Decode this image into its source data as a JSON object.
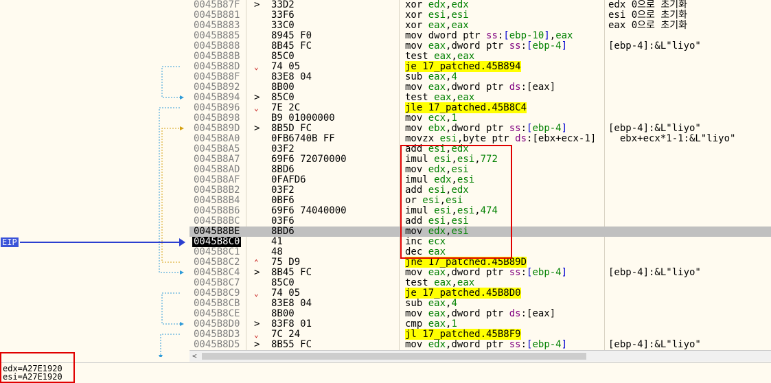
{
  "eip_label": "EIP",
  "colors": {
    "jump_highlight": "#ffff00",
    "eip_bg": "#3a53d8",
    "box": "#e00000",
    "current_row": "#c0c0c0"
  },
  "rows": [
    {
      "addr": "0045B87F",
      "mk": ">",
      "bytes": "33D2",
      "dis": [
        [
          "k",
          "xor "
        ],
        [
          "r",
          "edx"
        ],
        [
          "k",
          ","
        ],
        [
          "r",
          "edx"
        ]
      ],
      "cmt": "edx 0으로 초기화"
    },
    {
      "addr": "0045B881",
      "mk": "",
      "bytes": "33F6",
      "dis": [
        [
          "k",
          "xor "
        ],
        [
          "r",
          "esi"
        ],
        [
          "k",
          ","
        ],
        [
          "r",
          "esi"
        ]
      ],
      "cmt": "esi 0으로 초기화"
    },
    {
      "addr": "0045B883",
      "mk": "",
      "bytes": "33C0",
      "dis": [
        [
          "k",
          "xor "
        ],
        [
          "r",
          "eax"
        ],
        [
          "k",
          ","
        ],
        [
          "r",
          "eax"
        ]
      ],
      "cmt": "eax 0으로 초기화"
    },
    {
      "addr": "0045B885",
      "mk": "",
      "bytes": "8945 F0",
      "dis": [
        [
          "k",
          "mov dword ptr "
        ],
        [
          "s",
          "ss"
        ],
        [
          "k",
          ":"
        ],
        [
          "b",
          "["
        ],
        [
          "r",
          "ebp-10"
        ],
        [
          "b",
          "]"
        ],
        [
          "k",
          ","
        ],
        [
          "r",
          "eax"
        ]
      ],
      "cmt": ""
    },
    {
      "addr": "0045B888",
      "mk": "",
      "bytes": "8B45 FC",
      "dis": [
        [
          "k",
          "mov "
        ],
        [
          "r",
          "eax"
        ],
        [
          "k",
          ",dword ptr "
        ],
        [
          "s",
          "ss"
        ],
        [
          "k",
          ":"
        ],
        [
          "b",
          "["
        ],
        [
          "r",
          "ebp-4"
        ],
        [
          "b",
          "]"
        ]
      ],
      "cmt": "[ebp-4]:&L\"liyo\""
    },
    {
      "addr": "0045B88B",
      "mk": "",
      "bytes": "85C0",
      "dis": [
        [
          "k",
          "test "
        ],
        [
          "r",
          "eax"
        ],
        [
          "k",
          ","
        ],
        [
          "r",
          "eax"
        ]
      ],
      "cmt": ""
    },
    {
      "addr": "0045B88D",
      "mk": "v",
      "bytes": "74 05",
      "dis": [
        [
          "j",
          "je 17_patched.45B894"
        ]
      ],
      "cmt": ""
    },
    {
      "addr": "0045B88F",
      "mk": "",
      "bytes": "83E8 04",
      "dis": [
        [
          "k",
          "sub "
        ],
        [
          "r",
          "eax"
        ],
        [
          "k",
          ","
        ],
        [
          "n",
          "4"
        ]
      ],
      "cmt": ""
    },
    {
      "addr": "0045B892",
      "mk": "",
      "bytes": "8B00",
      "dis": [
        [
          "k",
          "mov "
        ],
        [
          "r",
          "eax"
        ],
        [
          "k",
          ",dword ptr "
        ],
        [
          "s",
          "ds"
        ],
        [
          "k",
          ":[eax]"
        ]
      ],
      "cmt": ""
    },
    {
      "addr": "0045B894",
      "mk": ">",
      "bytes": "85C0",
      "dis": [
        [
          "k",
          "test "
        ],
        [
          "r",
          "eax"
        ],
        [
          "k",
          ","
        ],
        [
          "r",
          "eax"
        ]
      ],
      "cmt": ""
    },
    {
      "addr": "0045B896",
      "mk": "v",
      "bytes": "7E 2C",
      "dis": [
        [
          "j",
          "jle 17_patched.45B8C4"
        ]
      ],
      "cmt": ""
    },
    {
      "addr": "0045B898",
      "mk": "",
      "bytes": "B9 01000000",
      "dis": [
        [
          "k",
          "mov "
        ],
        [
          "r",
          "ecx"
        ],
        [
          "k",
          ","
        ],
        [
          "n",
          "1"
        ]
      ],
      "cmt": ""
    },
    {
      "addr": "0045B89D",
      "mk": ">",
      "bytes": "8B5D FC",
      "dis": [
        [
          "k",
          "mov "
        ],
        [
          "r",
          "ebx"
        ],
        [
          "k",
          ",dword ptr "
        ],
        [
          "s",
          "ss"
        ],
        [
          "k",
          ":"
        ],
        [
          "b",
          "["
        ],
        [
          "r",
          "ebp-4"
        ],
        [
          "b",
          "]"
        ]
      ],
      "cmt": "[ebp-4]:&L\"liyo\""
    },
    {
      "addr": "0045B8A0",
      "mk": "",
      "bytes": "0FB6740B FF",
      "dis": [
        [
          "k",
          "movzx "
        ],
        [
          "r",
          "esi"
        ],
        [
          "k",
          ",byte ptr "
        ],
        [
          "s",
          "ds"
        ],
        [
          "k",
          ":[ebx+ecx-1]"
        ]
      ],
      "cmt": "  ebx+ecx*1-1:&L\"liyo\""
    },
    {
      "addr": "0045B8A5",
      "mk": "",
      "bytes": "03F2",
      "dis": [
        [
          "k",
          "add "
        ],
        [
          "r",
          "esi"
        ],
        [
          "k",
          ","
        ],
        [
          "r",
          "edx"
        ]
      ],
      "cmt": ""
    },
    {
      "addr": "0045B8A7",
      "mk": "",
      "bytes": "69F6 72070000",
      "dis": [
        [
          "k",
          "imul "
        ],
        [
          "r",
          "esi"
        ],
        [
          "k",
          ","
        ],
        [
          "r",
          "esi"
        ],
        [
          "k",
          ","
        ],
        [
          "n",
          "772"
        ]
      ],
      "cmt": ""
    },
    {
      "addr": "0045B8AD",
      "mk": "",
      "bytes": "8BD6",
      "dis": [
        [
          "k",
          "mov "
        ],
        [
          "r",
          "edx"
        ],
        [
          "k",
          ","
        ],
        [
          "r",
          "esi"
        ]
      ],
      "cmt": ""
    },
    {
      "addr": "0045B8AF",
      "mk": "",
      "bytes": "0FAFD6",
      "dis": [
        [
          "k",
          "imul "
        ],
        [
          "r",
          "edx"
        ],
        [
          "k",
          ","
        ],
        [
          "r",
          "esi"
        ]
      ],
      "cmt": ""
    },
    {
      "addr": "0045B8B2",
      "mk": "",
      "bytes": "03F2",
      "dis": [
        [
          "k",
          "add "
        ],
        [
          "r",
          "esi"
        ],
        [
          "k",
          ","
        ],
        [
          "r",
          "edx"
        ]
      ],
      "cmt": ""
    },
    {
      "addr": "0045B8B4",
      "mk": "",
      "bytes": "0BF6",
      "dis": [
        [
          "k",
          "or "
        ],
        [
          "r",
          "esi"
        ],
        [
          "k",
          ","
        ],
        [
          "r",
          "esi"
        ]
      ],
      "cmt": ""
    },
    {
      "addr": "0045B8B6",
      "mk": "",
      "bytes": "69F6 74040000",
      "dis": [
        [
          "k",
          "imul "
        ],
        [
          "r",
          "esi"
        ],
        [
          "k",
          ","
        ],
        [
          "r",
          "esi"
        ],
        [
          "k",
          ","
        ],
        [
          "n",
          "474"
        ]
      ],
      "cmt": ""
    },
    {
      "addr": "0045B8BC",
      "mk": "",
      "bytes": "03F6",
      "dis": [
        [
          "k",
          "add "
        ],
        [
          "r",
          "esi"
        ],
        [
          "k",
          ","
        ],
        [
          "r",
          "esi"
        ]
      ],
      "cmt": ""
    },
    {
      "addr": "0045B8BE",
      "mk": "",
      "bytes": "8BD6",
      "dis": [
        [
          "k",
          "mov "
        ],
        [
          "r",
          "edx"
        ],
        [
          "k",
          ","
        ],
        [
          "r",
          "esi"
        ]
      ],
      "cmt": "",
      "hl": true
    },
    {
      "addr": "0045B8C0",
      "mk": "",
      "bytes": "41",
      "dis": [
        [
          "k",
          "inc "
        ],
        [
          "r",
          "ecx"
        ]
      ],
      "cmt": "",
      "cur": true
    },
    {
      "addr": "0045B8C1",
      "mk": "",
      "bytes": "48",
      "dis": [
        [
          "k",
          "dec "
        ],
        [
          "r",
          "eax"
        ]
      ],
      "cmt": ""
    },
    {
      "addr": "0045B8C2",
      "mk": "^",
      "bytes": "75 D9",
      "dis": [
        [
          "j",
          "jne 17_patched.45B89D"
        ]
      ],
      "cmt": ""
    },
    {
      "addr": "0045B8C4",
      "mk": ">",
      "bytes": "8B45 FC",
      "dis": [
        [
          "k",
          "mov "
        ],
        [
          "r",
          "eax"
        ],
        [
          "k",
          ",dword ptr "
        ],
        [
          "s",
          "ss"
        ],
        [
          "k",
          ":"
        ],
        [
          "b",
          "["
        ],
        [
          "r",
          "ebp-4"
        ],
        [
          "b",
          "]"
        ]
      ],
      "cmt": "[ebp-4]:&L\"liyo\""
    },
    {
      "addr": "0045B8C7",
      "mk": "",
      "bytes": "85C0",
      "dis": [
        [
          "k",
          "test "
        ],
        [
          "r",
          "eax"
        ],
        [
          "k",
          ","
        ],
        [
          "r",
          "eax"
        ]
      ],
      "cmt": ""
    },
    {
      "addr": "0045B8C9",
      "mk": "v",
      "bytes": "74 05",
      "dis": [
        [
          "j",
          "je 17_patched.45B8D0"
        ]
      ],
      "cmt": ""
    },
    {
      "addr": "0045B8CB",
      "mk": "",
      "bytes": "83E8 04",
      "dis": [
        [
          "k",
          "sub "
        ],
        [
          "r",
          "eax"
        ],
        [
          "k",
          ","
        ],
        [
          "n",
          "4"
        ]
      ],
      "cmt": ""
    },
    {
      "addr": "0045B8CE",
      "mk": "",
      "bytes": "8B00",
      "dis": [
        [
          "k",
          "mov "
        ],
        [
          "r",
          "eax"
        ],
        [
          "k",
          ",dword ptr "
        ],
        [
          "s",
          "ds"
        ],
        [
          "k",
          ":[eax]"
        ]
      ],
      "cmt": ""
    },
    {
      "addr": "0045B8D0",
      "mk": ">",
      "bytes": "83F8 01",
      "dis": [
        [
          "k",
          "cmp "
        ],
        [
          "r",
          "eax"
        ],
        [
          "k",
          ","
        ],
        [
          "n",
          "1"
        ]
      ],
      "cmt": ""
    },
    {
      "addr": "0045B8D3",
      "mk": "v",
      "bytes": "7C 24",
      "dis": [
        [
          "j",
          "jl 17_patched.45B8F9"
        ]
      ],
      "cmt": ""
    },
    {
      "addr": "0045B8D5",
      "mk": ">",
      "bytes": "8B55 FC",
      "dis": [
        [
          "k",
          "mov "
        ],
        [
          "r",
          "edx"
        ],
        [
          "k",
          ",dword ptr "
        ],
        [
          "s",
          "ss"
        ],
        [
          "k",
          ":"
        ],
        [
          "b",
          "["
        ],
        [
          "r",
          "ebp-4"
        ],
        [
          "b",
          "]"
        ]
      ],
      "cmt": "[ebp-4]:&L\"liyo\""
    }
  ],
  "info": {
    "line1": "edx=A27E1920",
    "line2": "esi=A27E1920"
  },
  "scroll_left_glyph": "<"
}
